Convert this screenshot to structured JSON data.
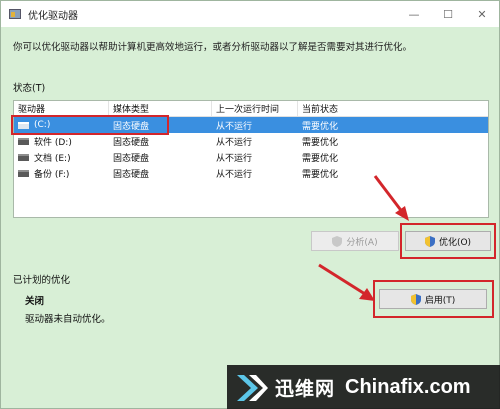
{
  "window": {
    "title": "优化驱动器",
    "minimize_glyph": "—",
    "maximize_glyph": "☐",
    "close_glyph": "✕"
  },
  "intro_text": "你可以优化驱动器以帮助计算机更高效地运行，或者分析驱动器以了解是否需要对其进行优化。",
  "status_label": "状态(T)",
  "table": {
    "headers": [
      "驱动器",
      "媒体类型",
      "上一次运行时间",
      "当前状态"
    ],
    "rows": [
      {
        "drive": "(C:)",
        "media": "固态硬盘",
        "last_run": "从不运行",
        "status": "需要优化"
      },
      {
        "drive": "软件 (D:)",
        "media": "固态硬盘",
        "last_run": "从不运行",
        "status": "需要优化"
      },
      {
        "drive": "文档 (E:)",
        "media": "固态硬盘",
        "last_run": "从不运行",
        "status": "需要优化"
      },
      {
        "drive": "备份 (F:)",
        "media": "固态硬盘",
        "last_run": "从不运行",
        "status": "需要优化"
      }
    ]
  },
  "buttons": {
    "analyze": "分析(A)",
    "optimize": "优化(O)",
    "enable": "启用(T)"
  },
  "scheduled": {
    "label": "已计划的优化",
    "state": "关闭",
    "description": "驱动器未自动优化。"
  },
  "watermark": {
    "cn": "迅维网",
    "en": "Chinafix.com"
  },
  "colors": {
    "background": "#d8efd6",
    "selection": "#3a8fe0",
    "highlight_red": "#d3262b"
  }
}
